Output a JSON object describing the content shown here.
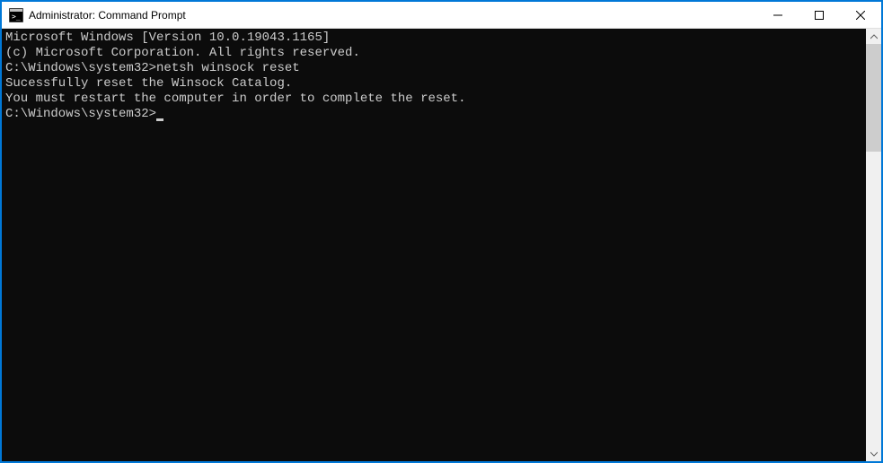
{
  "titlebar": {
    "title": "Administrator: Command Prompt"
  },
  "terminal": {
    "lines": [
      "Microsoft Windows [Version 10.0.19043.1165]",
      "(c) Microsoft Corporation. All rights reserved.",
      "",
      "C:\\Windows\\system32>netsh winsock reset",
      "",
      "Sucessfully reset the Winsock Catalog.",
      "You must restart the computer in order to complete the reset.",
      "",
      ""
    ],
    "prompt": "C:\\Windows\\system32>"
  }
}
